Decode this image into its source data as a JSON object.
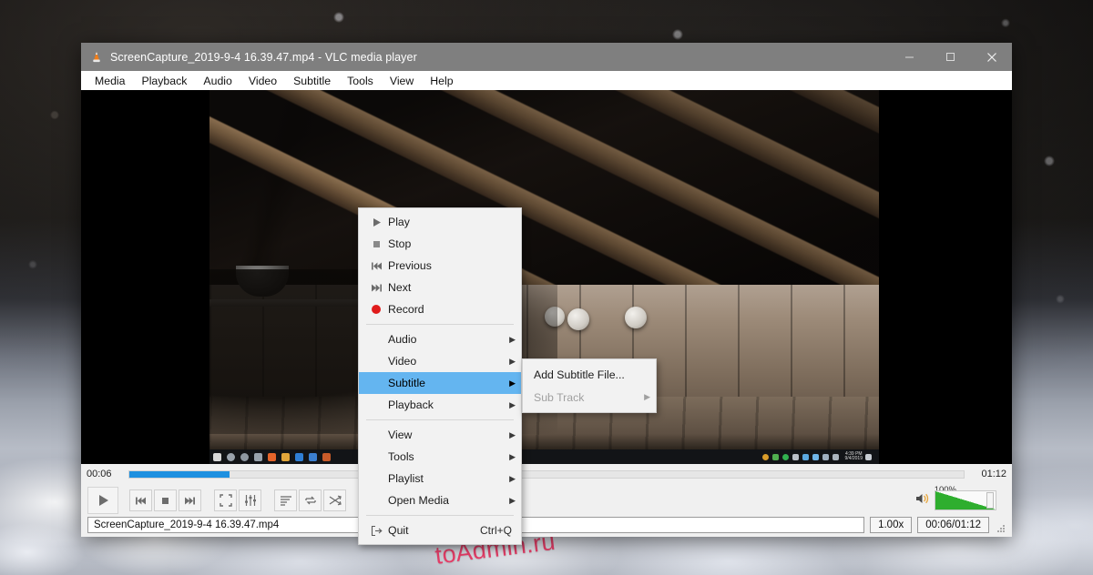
{
  "desktop": {
    "watermark": "toAdmin.ru"
  },
  "window": {
    "title": "ScreenCapture_2019-9-4 16.39.47.mp4 - VLC media player",
    "app_icon": "vlc-cone-icon",
    "controls": {
      "minimize": "—",
      "maximize": "☐",
      "close": "✕"
    }
  },
  "menubar": {
    "items": [
      {
        "label": "Media"
      },
      {
        "label": "Playback"
      },
      {
        "label": "Audio"
      },
      {
        "label": "Video"
      },
      {
        "label": "Subtitle"
      },
      {
        "label": "Tools"
      },
      {
        "label": "View"
      },
      {
        "label": "Help"
      }
    ]
  },
  "context_menu": {
    "items": [
      {
        "label": "Play",
        "icon": "play-icon",
        "type": "action",
        "selected": false
      },
      {
        "label": "Stop",
        "icon": "stop-icon",
        "type": "action",
        "selected": false
      },
      {
        "label": "Previous",
        "icon": "previous-icon",
        "type": "action",
        "selected": false
      },
      {
        "label": "Next",
        "icon": "next-icon",
        "type": "action",
        "selected": false
      },
      {
        "label": "Record",
        "icon": "record-icon",
        "type": "action",
        "selected": false
      },
      {
        "label": "Audio",
        "icon": "",
        "type": "submenu",
        "selected": false
      },
      {
        "label": "Video",
        "icon": "",
        "type": "submenu",
        "selected": false
      },
      {
        "label": "Subtitle",
        "icon": "",
        "type": "submenu",
        "selected": true
      },
      {
        "label": "Playback",
        "icon": "",
        "type": "submenu",
        "selected": false
      },
      {
        "label": "View",
        "icon": "",
        "type": "submenu",
        "selected": false
      },
      {
        "label": "Tools",
        "icon": "",
        "type": "submenu",
        "selected": false
      },
      {
        "label": "Playlist",
        "icon": "",
        "type": "submenu",
        "selected": false
      },
      {
        "label": "Open Media",
        "icon": "",
        "type": "submenu",
        "selected": false
      },
      {
        "label": "Quit",
        "icon": "quit-icon",
        "type": "action",
        "accel": "Ctrl+Q",
        "selected": false
      }
    ]
  },
  "submenu": {
    "parent": "Subtitle",
    "items": [
      {
        "label": "Add Subtitle File...",
        "type": "action",
        "disabled": false
      },
      {
        "label": "Sub Track",
        "type": "submenu",
        "disabled": true
      }
    ]
  },
  "player": {
    "elapsed": "00:06",
    "total": "01:12",
    "progress_percent": 12,
    "speed": "1.00x",
    "time_display": "00:06/01:12",
    "volume_label": "100%",
    "volume_percent": 100,
    "media_name": "ScreenCapture_2019-9-4 16.39.47.mp4",
    "buttons": [
      {
        "name": "play-button",
        "icon": "play-icon"
      },
      {
        "name": "previous-button",
        "icon": "previous-icon"
      },
      {
        "name": "stop-button",
        "icon": "stop-icon"
      },
      {
        "name": "next-button",
        "icon": "next-icon"
      },
      {
        "name": "fullscreen-button",
        "icon": "fullscreen-icon"
      },
      {
        "name": "extended-settings-button",
        "icon": "equalizer-icon"
      },
      {
        "name": "playlist-button",
        "icon": "playlist-icon"
      },
      {
        "name": "loop-button",
        "icon": "loop-icon"
      },
      {
        "name": "shuffle-button",
        "icon": "shuffle-icon"
      }
    ]
  },
  "colors": {
    "titlebar": "#7f7f7f",
    "menu_highlight": "#64b5f0",
    "seek_fill": "#1e90e0",
    "volume_fill": "#2eae2e",
    "watermark": "#e8325f"
  }
}
